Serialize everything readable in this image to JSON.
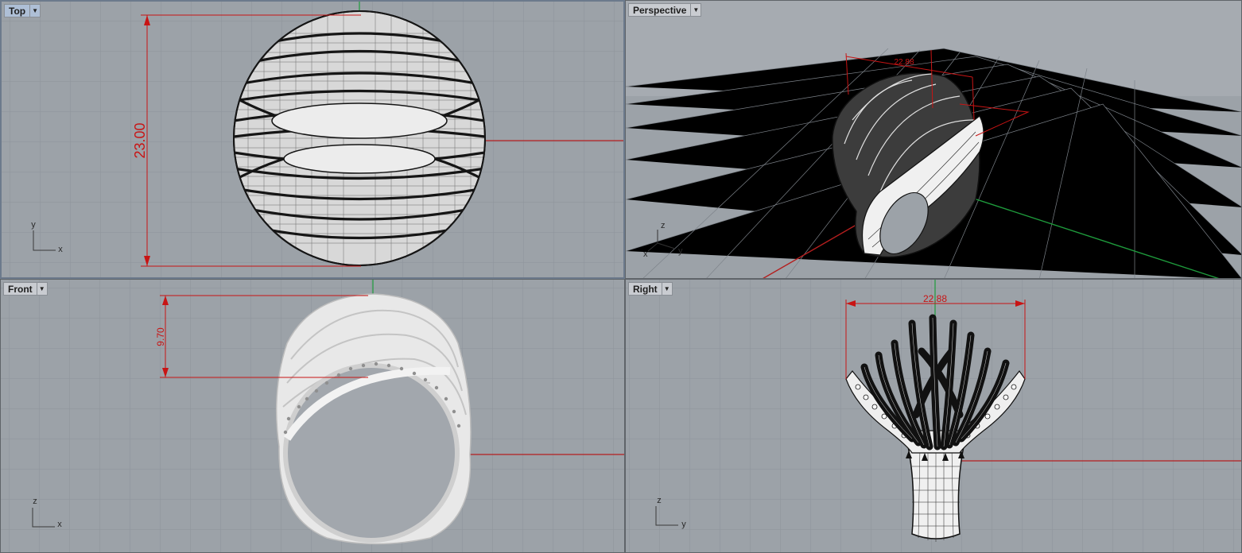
{
  "viewports": {
    "top": {
      "label": "Top",
      "dimension": "23.00",
      "axes": {
        "h": "x",
        "v": "y"
      }
    },
    "perspective": {
      "label": "Perspective",
      "dimension": "22.88",
      "axes": {
        "a": "x",
        "b": "y",
        "c": "z"
      }
    },
    "front": {
      "label": "Front",
      "dimension": "9.70",
      "axes": {
        "h": "x",
        "v": "z"
      }
    },
    "right": {
      "label": "Right",
      "dimension": "22.88",
      "axes": {
        "h": "y",
        "v": "z"
      }
    }
  },
  "colors": {
    "viewport_bg": "#9ca2a8",
    "grid_minor": "#8d939a",
    "grid_major": "#7c8289",
    "x_axis": "#b41e1e",
    "y_axis": "#1e9b3c",
    "dimension": "#c81414",
    "model_wire": "#151515",
    "model_render": "#e6e6e6"
  },
  "icons": {
    "dropdown": "chevron-down-icon"
  }
}
